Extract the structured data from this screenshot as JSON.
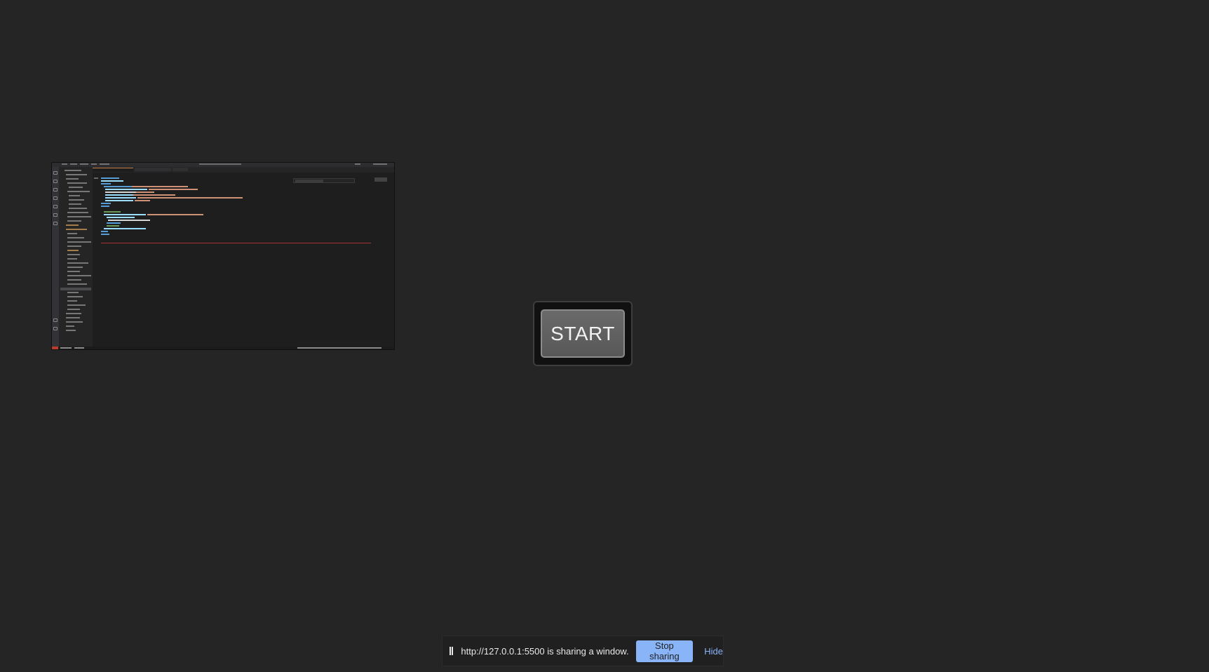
{
  "start_button": {
    "label": "START"
  },
  "share_bar": {
    "message": "http://127.0.0.1:5500 is sharing a window.",
    "stop_label": "Stop sharing",
    "hide_label": "Hide"
  },
  "colors": {
    "background": "#252526",
    "accent": "#8ab4f8",
    "button": "#606060"
  }
}
